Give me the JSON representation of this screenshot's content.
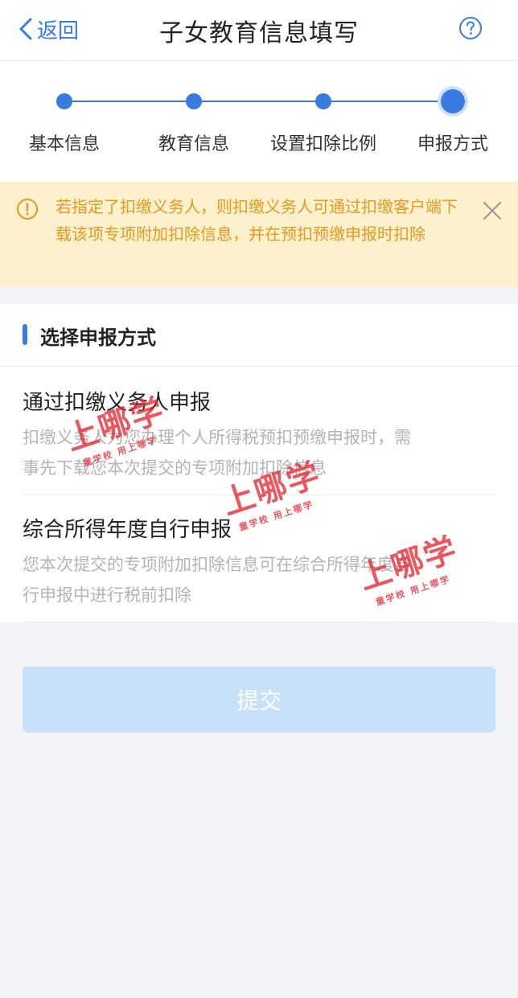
{
  "header": {
    "back_label": "返回",
    "title": "子女教育信息填写"
  },
  "stepper": {
    "steps": [
      {
        "label": "基本信息"
      },
      {
        "label": "教育信息"
      },
      {
        "label": "设置扣除比例"
      },
      {
        "label": "申报方式"
      }
    ],
    "active_index": 3
  },
  "notice": {
    "text": "若指定了扣缴义务人，则扣缴义务人可通过扣缴客户端下载该项专项附加扣除信息，并在预扣预缴申报时扣除"
  },
  "section": {
    "title": "选择申报方式",
    "options": [
      {
        "title": "通过扣缴义务人申报",
        "desc": "扣缴义务人为您办理个人所得税预扣预缴申报时，需事先下载您本次提交的专项附加扣除信息"
      },
      {
        "title": "综合所得年度自行申报",
        "desc": "您本次提交的专项附加扣除信息可在综合所得年度自行申报中进行税前扣除"
      }
    ]
  },
  "submit_label": "提交",
  "watermark": {
    "brand": "上哪学",
    "tagline": "童学校 用上哪学"
  },
  "colors": {
    "accent": "#3a7be0",
    "notice_bg": "#fdf0cc",
    "notice_text": "#e39a1e",
    "submit_disabled": "#c9e0fa"
  }
}
